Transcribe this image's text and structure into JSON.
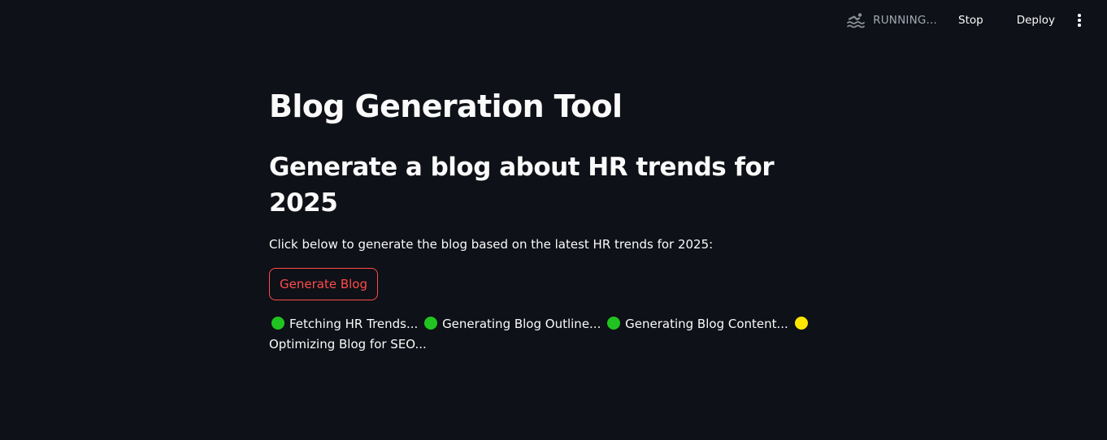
{
  "toolbar": {
    "status_icon": "swimmer-icon",
    "status_text": "RUNNING...",
    "stop_label": "Stop",
    "deploy_label": "Deploy",
    "menu_icon": "vertical-ellipsis-icon"
  },
  "main": {
    "title": "Blog Generation Tool",
    "subheader": "Generate a blog about HR trends for 2025",
    "caption": "Click below to generate the blog based on the latest HR trends for 2025:",
    "button_label": "Generate Blog",
    "steps": [
      {
        "label": "Fetching HR Trends...",
        "status": "done",
        "color": "#21c321"
      },
      {
        "label": "Generating Blog Outline...",
        "status": "done",
        "color": "#21c321"
      },
      {
        "label": "Generating Blog Content...",
        "status": "done",
        "color": "#21c321"
      },
      {
        "label": "Optimizing Blog for SEO...",
        "status": "in-progress",
        "color": "#ffe600"
      }
    ]
  },
  "colors": {
    "background": "#0e1117",
    "text": "#fafafa",
    "accent": "#ff4b4b",
    "muted": "#a3a8b4"
  }
}
